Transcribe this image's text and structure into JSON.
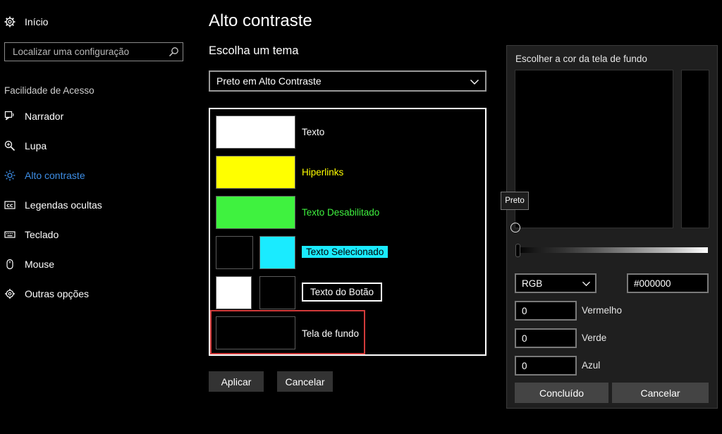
{
  "sidebar": {
    "home": {
      "label": "Início",
      "icon": "gear-icon"
    },
    "search": {
      "placeholder": "Localizar uma configuração",
      "icon": "search-icon"
    },
    "section_title": "Facilidade de Acesso",
    "items": [
      {
        "label": "Narrador",
        "icon": "narrator-icon"
      },
      {
        "label": "Lupa",
        "icon": "magnifier-icon"
      },
      {
        "label": "Alto contraste",
        "icon": "brightness-icon",
        "active": true
      },
      {
        "label": "Legendas ocultas",
        "icon": "closed-captions-icon"
      },
      {
        "label": "Teclado",
        "icon": "keyboard-icon"
      },
      {
        "label": "Mouse",
        "icon": "mouse-icon"
      },
      {
        "label": "Outras opções",
        "icon": "settings-icon"
      }
    ],
    "active_color": "#3d8ee6"
  },
  "main": {
    "title": "Alto contraste",
    "subtitle": "Escolha um tema",
    "theme_select": {
      "value": "Preto em Alto Contraste"
    },
    "theme_items": {
      "text": {
        "label": "Texto",
        "color": "#ffffff"
      },
      "hyperlinks": {
        "label": "Hiperlinks",
        "color": "#ffff00"
      },
      "disabled_text": {
        "label": "Texto Desabilitado",
        "color": "#3ff23f"
      },
      "selected_text": {
        "label": "Texto Selecionado",
        "bg": "#000000",
        "fg": "#1aebff"
      },
      "button_text": {
        "label": "Texto do Botão",
        "bg": "#ffffff",
        "fg": "#000000"
      },
      "background": {
        "label": "Tela de fundo",
        "color": "#000000"
      }
    },
    "apply_label": "Aplicar",
    "cancel_label": "Cancelar"
  },
  "color_dialog": {
    "title": "Escolher a cor da tela de fundo",
    "tooltip": "Preto",
    "mode": "RGB",
    "hex": "#000000",
    "red": {
      "label": "Vermelho",
      "value": "0"
    },
    "green": {
      "label": "Verde",
      "value": "0"
    },
    "blue": {
      "label": "Azul",
      "value": "0"
    },
    "done_label": "Concluído",
    "cancel_label": "Cancelar"
  }
}
